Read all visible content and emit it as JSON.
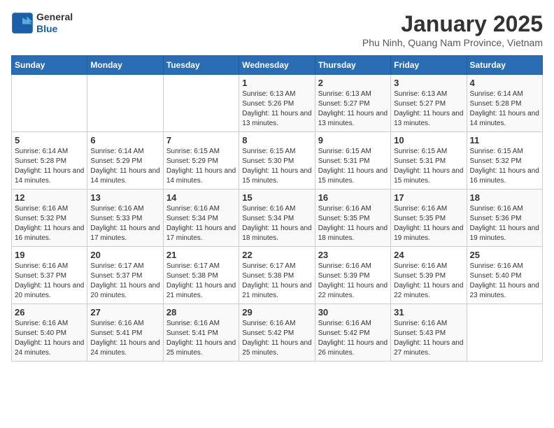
{
  "logo": {
    "line1": "General",
    "line2": "Blue"
  },
  "title": "January 2025",
  "location": "Phu Ninh, Quang Nam Province, Vietnam",
  "days_of_week": [
    "Sunday",
    "Monday",
    "Tuesday",
    "Wednesday",
    "Thursday",
    "Friday",
    "Saturday"
  ],
  "weeks": [
    [
      {
        "day": "",
        "sunrise": "",
        "sunset": "",
        "daylight": ""
      },
      {
        "day": "",
        "sunrise": "",
        "sunset": "",
        "daylight": ""
      },
      {
        "day": "",
        "sunrise": "",
        "sunset": "",
        "daylight": ""
      },
      {
        "day": "1",
        "sunrise": "Sunrise: 6:13 AM",
        "sunset": "Sunset: 5:26 PM",
        "daylight": "Daylight: 11 hours and 13 minutes."
      },
      {
        "day": "2",
        "sunrise": "Sunrise: 6:13 AM",
        "sunset": "Sunset: 5:27 PM",
        "daylight": "Daylight: 11 hours and 13 minutes."
      },
      {
        "day": "3",
        "sunrise": "Sunrise: 6:13 AM",
        "sunset": "Sunset: 5:27 PM",
        "daylight": "Daylight: 11 hours and 13 minutes."
      },
      {
        "day": "4",
        "sunrise": "Sunrise: 6:14 AM",
        "sunset": "Sunset: 5:28 PM",
        "daylight": "Daylight: 11 hours and 14 minutes."
      }
    ],
    [
      {
        "day": "5",
        "sunrise": "Sunrise: 6:14 AM",
        "sunset": "Sunset: 5:28 PM",
        "daylight": "Daylight: 11 hours and 14 minutes."
      },
      {
        "day": "6",
        "sunrise": "Sunrise: 6:14 AM",
        "sunset": "Sunset: 5:29 PM",
        "daylight": "Daylight: 11 hours and 14 minutes."
      },
      {
        "day": "7",
        "sunrise": "Sunrise: 6:15 AM",
        "sunset": "Sunset: 5:29 PM",
        "daylight": "Daylight: 11 hours and 14 minutes."
      },
      {
        "day": "8",
        "sunrise": "Sunrise: 6:15 AM",
        "sunset": "Sunset: 5:30 PM",
        "daylight": "Daylight: 11 hours and 15 minutes."
      },
      {
        "day": "9",
        "sunrise": "Sunrise: 6:15 AM",
        "sunset": "Sunset: 5:31 PM",
        "daylight": "Daylight: 11 hours and 15 minutes."
      },
      {
        "day": "10",
        "sunrise": "Sunrise: 6:15 AM",
        "sunset": "Sunset: 5:31 PM",
        "daylight": "Daylight: 11 hours and 15 minutes."
      },
      {
        "day": "11",
        "sunrise": "Sunrise: 6:15 AM",
        "sunset": "Sunset: 5:32 PM",
        "daylight": "Daylight: 11 hours and 16 minutes."
      }
    ],
    [
      {
        "day": "12",
        "sunrise": "Sunrise: 6:16 AM",
        "sunset": "Sunset: 5:32 PM",
        "daylight": "Daylight: 11 hours and 16 minutes."
      },
      {
        "day": "13",
        "sunrise": "Sunrise: 6:16 AM",
        "sunset": "Sunset: 5:33 PM",
        "daylight": "Daylight: 11 hours and 17 minutes."
      },
      {
        "day": "14",
        "sunrise": "Sunrise: 6:16 AM",
        "sunset": "Sunset: 5:34 PM",
        "daylight": "Daylight: 11 hours and 17 minutes."
      },
      {
        "day": "15",
        "sunrise": "Sunrise: 6:16 AM",
        "sunset": "Sunset: 5:34 PM",
        "daylight": "Daylight: 11 hours and 18 minutes."
      },
      {
        "day": "16",
        "sunrise": "Sunrise: 6:16 AM",
        "sunset": "Sunset: 5:35 PM",
        "daylight": "Daylight: 11 hours and 18 minutes."
      },
      {
        "day": "17",
        "sunrise": "Sunrise: 6:16 AM",
        "sunset": "Sunset: 5:35 PM",
        "daylight": "Daylight: 11 hours and 19 minutes."
      },
      {
        "day": "18",
        "sunrise": "Sunrise: 6:16 AM",
        "sunset": "Sunset: 5:36 PM",
        "daylight": "Daylight: 11 hours and 19 minutes."
      }
    ],
    [
      {
        "day": "19",
        "sunrise": "Sunrise: 6:16 AM",
        "sunset": "Sunset: 5:37 PM",
        "daylight": "Daylight: 11 hours and 20 minutes."
      },
      {
        "day": "20",
        "sunrise": "Sunrise: 6:17 AM",
        "sunset": "Sunset: 5:37 PM",
        "daylight": "Daylight: 11 hours and 20 minutes."
      },
      {
        "day": "21",
        "sunrise": "Sunrise: 6:17 AM",
        "sunset": "Sunset: 5:38 PM",
        "daylight": "Daylight: 11 hours and 21 minutes."
      },
      {
        "day": "22",
        "sunrise": "Sunrise: 6:17 AM",
        "sunset": "Sunset: 5:38 PM",
        "daylight": "Daylight: 11 hours and 21 minutes."
      },
      {
        "day": "23",
        "sunrise": "Sunrise: 6:16 AM",
        "sunset": "Sunset: 5:39 PM",
        "daylight": "Daylight: 11 hours and 22 minutes."
      },
      {
        "day": "24",
        "sunrise": "Sunrise: 6:16 AM",
        "sunset": "Sunset: 5:39 PM",
        "daylight": "Daylight: 11 hours and 22 minutes."
      },
      {
        "day": "25",
        "sunrise": "Sunrise: 6:16 AM",
        "sunset": "Sunset: 5:40 PM",
        "daylight": "Daylight: 11 hours and 23 minutes."
      }
    ],
    [
      {
        "day": "26",
        "sunrise": "Sunrise: 6:16 AM",
        "sunset": "Sunset: 5:40 PM",
        "daylight": "Daylight: 11 hours and 24 minutes."
      },
      {
        "day": "27",
        "sunrise": "Sunrise: 6:16 AM",
        "sunset": "Sunset: 5:41 PM",
        "daylight": "Daylight: 11 hours and 24 minutes."
      },
      {
        "day": "28",
        "sunrise": "Sunrise: 6:16 AM",
        "sunset": "Sunset: 5:41 PM",
        "daylight": "Daylight: 11 hours and 25 minutes."
      },
      {
        "day": "29",
        "sunrise": "Sunrise: 6:16 AM",
        "sunset": "Sunset: 5:42 PM",
        "daylight": "Daylight: 11 hours and 25 minutes."
      },
      {
        "day": "30",
        "sunrise": "Sunrise: 6:16 AM",
        "sunset": "Sunset: 5:42 PM",
        "daylight": "Daylight: 11 hours and 26 minutes."
      },
      {
        "day": "31",
        "sunrise": "Sunrise: 6:16 AM",
        "sunset": "Sunset: 5:43 PM",
        "daylight": "Daylight: 11 hours and 27 minutes."
      },
      {
        "day": "",
        "sunrise": "",
        "sunset": "",
        "daylight": ""
      }
    ]
  ]
}
